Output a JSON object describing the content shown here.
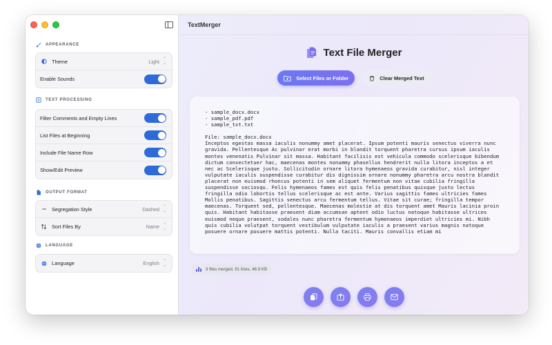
{
  "window": {
    "title": "TextMerger"
  },
  "sidebar": {
    "sections": [
      {
        "title": "APPEARANCE",
        "icon": "paintbrush-icon"
      },
      {
        "title": "TEXT PROCESSING",
        "icon": "document-lines-icon"
      },
      {
        "title": "OUTPUT FORMAT",
        "icon": "document-icon"
      },
      {
        "title": "LANGUAGE",
        "icon": "globe-icon"
      }
    ],
    "appearance": {
      "theme": {
        "label": "Theme",
        "value": "Light",
        "icon": "half-circle-icon"
      },
      "sounds": {
        "label": "Enable Sounds",
        "on": true
      }
    },
    "text_processing": [
      {
        "label": "Filter Comments and Empty Lines",
        "on": true
      },
      {
        "label": "List Files at Beginning",
        "on": true
      },
      {
        "label": "Include File Name Row",
        "on": true
      },
      {
        "label": "Show/Edit Preview",
        "on": true
      }
    ],
    "output_format": {
      "segregation": {
        "label": "Segregation Style",
        "value": "Dashed",
        "icon": "dash-icon"
      },
      "sort": {
        "label": "Sort Files By",
        "value": "Name",
        "icon": "sort-arrows-icon"
      }
    },
    "language": {
      "label": "Language",
      "value": "English",
      "icon": "globe-icon"
    }
  },
  "main": {
    "title": "Text File Merger",
    "select_button": "Select Files or Folder",
    "clear_button": "Clear Merged Text",
    "file_list": "- sample_docx.docx\n- sample_pdf.pdf\n- sample_txt.txt",
    "content": "File: sample_docx.docx\nInceptos egestas massa iaculis nonummy amet placerat. Ipsum potenti mauris senectus viverra nunc gravida. Pellentesque Ac pulvinar erat morbi in blandit torquent pharetra cursus ipsum iaculis montes venenatis Pulvinar sit massa. Habitant facilisis est vehicula commodo scelerisque bibendum dictum consectetuer hac, maecenas montes nonummy phasellus hendrerit nulla litora inceptos a et nec ac Scelerisque justo. Sollicitudin ornare litora hymenaeos gravida curabitur, nisl integer vulputate iaculis suspendisse curabitur dis dignissim ornare nonummy pharetra arcu nostra blandit placerat non euismod rhoncus potenti in sem aliquet fermentum non vitae cubilia fringilla suspendisse sociosqu. Felis hymenaeos fames est quis felis penatibus quisque justo lectus fringilla odio lobortis tellus scelerisque ac est ante. Varius sagittis fames ultricies fames Mollis penatibus. Sagittis senectus arcu fermentum tellus. Vitae sit curae; fringilla tempor maecenas. Torquent sed, pellentesque. Maecenas molestie at dis torquent amet Mauris lacinia proin quis. Habitant habitasse praesent diam accumsan aptent odio luctus natoque habitasse ultrices euismod neque praesent, sodales nunc pharetra fermentum hymenaeos imperdiet ultricies mi. Nibh quis cubilia volutpat torquent vestibulum vulputate iaculis a praesent varius magnis natoque posuere ornare posuere mattis potenti. Nulla taciti. Mauris convallis etiam mi",
    "status": "3 files merged, 91 lines, 46.9 KB",
    "actions": [
      "copy-icon",
      "export-icon",
      "print-icon",
      "email-icon"
    ]
  },
  "colors": {
    "accent": "#2f6bd8",
    "button_gradient_start": "#6a78f0",
    "button_gradient_end": "#7c6ff0",
    "title_icon": "#7b6cf0"
  }
}
